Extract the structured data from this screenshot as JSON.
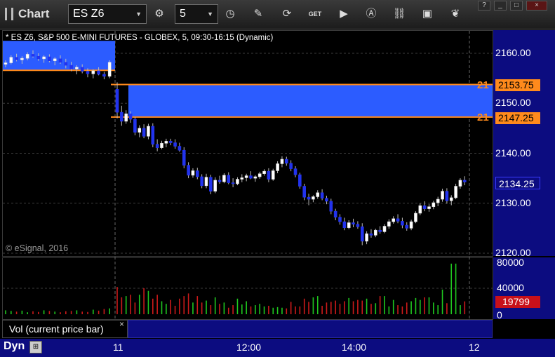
{
  "app": {
    "title": "Chart"
  },
  "toolbar": {
    "symbol": "ES Z6",
    "interval": "5",
    "tools": [
      "clock-icon",
      "pencil-icon",
      "refresh-icon",
      "get-icon",
      "play-icon",
      "alert-icon",
      "link-icon",
      "comment-icon",
      "twitter-icon"
    ],
    "get_label": "GET"
  },
  "window_buttons": {
    "help": "?",
    "minimize": "_",
    "maximize": "□",
    "close": "×"
  },
  "chart_title": "* ES Z6, S&P 500 E-MINI FUTURES - GLOBEX, 5, 09:30-16:15 (Dynamic)",
  "copyright": "© eSignal, 2016",
  "price_axis": {
    "ticks": [
      "2160.00",
      "2150.00",
      "2140.00",
      "2130.00",
      "2120.00"
    ]
  },
  "volume_axis": {
    "ticks": [
      "80000",
      "40000",
      "0"
    ]
  },
  "horizontal_lines": [
    {
      "prefix": "21",
      "label": "2153.75",
      "value": 2153.75
    },
    {
      "prefix": "21",
      "label": "2147.25",
      "value": 2147.25
    }
  ],
  "last_price_label": "2134.25",
  "current_volume_label": "19799",
  "study_label": "Vol (current price bar)",
  "study_close": "×",
  "bottom": {
    "mode": "Dyn",
    "time_ticks": [
      "11",
      "12:00",
      "14:00",
      "12"
    ]
  },
  "colors": {
    "zone": "#2c5cff",
    "zone_line": "#ff8a1c",
    "up_volume": "#1fc81f",
    "down_volume": "#cc1a1a",
    "axis_panel": "#0c0c80"
  },
  "chart_data": {
    "type": "candlestick",
    "ylim": [
      2119,
      2167
    ],
    "volume_ylim": [
      0,
      85000
    ],
    "zones": [
      {
        "from": 2156.6,
        "to": 2162.5,
        "session": "prior"
      },
      {
        "from": 2147.25,
        "to": 2153.75,
        "session": "current"
      }
    ],
    "candles_prior": [
      [
        2157.8,
        2158.6,
        2157.2,
        2158.1
      ],
      [
        2158.1,
        2159.6,
        2157.8,
        2159.2
      ],
      [
        2159.2,
        2159.9,
        2158.4,
        2158.7
      ],
      [
        2158.7,
        2159.4,
        2157.9,
        2159.0
      ],
      [
        2159.0,
        2160.2,
        2158.6,
        2159.8
      ],
      [
        2159.8,
        2160.6,
        2159.1,
        2159.4
      ],
      [
        2159.4,
        2160.0,
        2158.5,
        2158.9
      ],
      [
        2158.9,
        2159.6,
        2158.1,
        2159.3
      ],
      [
        2159.3,
        2159.8,
        2158.2,
        2158.5
      ],
      [
        2158.5,
        2159.2,
        2157.6,
        2158.9
      ],
      [
        2158.9,
        2159.6,
        2157.9,
        2158.2
      ],
      [
        2158.2,
        2158.9,
        2157.0,
        2157.6
      ],
      [
        2157.6,
        2158.3,
        2156.4,
        2156.9
      ],
      [
        2156.9,
        2157.6,
        2155.8,
        2157.2
      ],
      [
        2157.2,
        2157.8,
        2156.0,
        2156.4
      ],
      [
        2156.4,
        2157.0,
        2155.2,
        2155.9
      ],
      [
        2155.9,
        2156.8,
        2155.0,
        2156.5
      ],
      [
        2156.5,
        2157.2,
        2155.6,
        2155.8
      ],
      [
        2155.8,
        2156.3,
        2154.8,
        2155.4
      ],
      [
        2155.4,
        2158.6,
        2155.0,
        2158.2
      ]
    ],
    "candles": [
      [
        2152.8,
        2154.2,
        2147.0,
        2148.2
      ],
      [
        2148.2,
        2149.5,
        2145.5,
        2146.4
      ],
      [
        2146.4,
        2148.6,
        2145.9,
        2147.9
      ],
      [
        2147.9,
        2148.4,
        2146.1,
        2146.8
      ],
      [
        2146.8,
        2147.2,
        2143.6,
        2144.2
      ],
      [
        2144.2,
        2145.6,
        2143.2,
        2145.0
      ],
      [
        2145.0,
        2145.8,
        2143.0,
        2143.4
      ],
      [
        2143.4,
        2145.9,
        2142.8,
        2145.4
      ],
      [
        2145.4,
        2146.0,
        2141.2,
        2141.8
      ],
      [
        2141.8,
        2142.8,
        2140.4,
        2141.1
      ],
      [
        2141.1,
        2142.5,
        2140.8,
        2142.0
      ],
      [
        2142.0,
        2142.9,
        2141.2,
        2142.4
      ],
      [
        2142.4,
        2142.9,
        2141.6,
        2142.1
      ],
      [
        2142.1,
        2142.8,
        2140.9,
        2141.4
      ],
      [
        2141.4,
        2142.1,
        2140.3,
        2140.6
      ],
      [
        2140.6,
        2141.2,
        2137.0,
        2137.6
      ],
      [
        2137.6,
        2138.2,
        2135.0,
        2135.6
      ],
      [
        2135.6,
        2137.0,
        2135.1,
        2136.5
      ],
      [
        2136.5,
        2137.1,
        2134.8,
        2135.3
      ],
      [
        2135.3,
        2135.8,
        2133.0,
        2133.5
      ],
      [
        2133.5,
        2135.9,
        2133.0,
        2135.2
      ],
      [
        2135.2,
        2135.7,
        2131.8,
        2132.4
      ],
      [
        2132.4,
        2135.2,
        2132.0,
        2134.6
      ],
      [
        2134.6,
        2135.5,
        2133.9,
        2134.3
      ],
      [
        2134.3,
        2136.0,
        2134.0,
        2135.6
      ],
      [
        2135.6,
        2136.2,
        2133.8,
        2134.1
      ],
      [
        2134.1,
        2135.0,
        2133.2,
        2133.9
      ],
      [
        2133.9,
        2135.2,
        2133.6,
        2134.8
      ],
      [
        2134.8,
        2135.8,
        2134.2,
        2135.1
      ],
      [
        2135.1,
        2135.9,
        2134.4,
        2135.5
      ],
      [
        2135.5,
        2136.4,
        2134.8,
        2135.0
      ],
      [
        2135.0,
        2135.6,
        2134.3,
        2135.3
      ],
      [
        2135.3,
        2136.3,
        2134.9,
        2135.9
      ],
      [
        2135.9,
        2136.8,
        2135.5,
        2136.4
      ],
      [
        2136.4,
        2137.0,
        2134.2,
        2134.8
      ],
      [
        2134.8,
        2136.9,
        2134.5,
        2136.5
      ],
      [
        2136.5,
        2138.4,
        2136.0,
        2137.9
      ],
      [
        2137.9,
        2139.4,
        2137.2,
        2138.8
      ],
      [
        2138.8,
        2139.3,
        2137.5,
        2138.0
      ],
      [
        2138.0,
        2138.6,
        2136.4,
        2136.9
      ],
      [
        2136.9,
        2137.4,
        2135.2,
        2135.7
      ],
      [
        2135.7,
        2136.1,
        2132.9,
        2133.4
      ],
      [
        2133.4,
        2133.9,
        2130.6,
        2131.2
      ],
      [
        2131.2,
        2131.9,
        2129.6,
        2130.8
      ],
      [
        2130.8,
        2131.6,
        2130.2,
        2131.3
      ],
      [
        2131.3,
        2132.6,
        2130.9,
        2132.1
      ],
      [
        2132.1,
        2132.8,
        2130.6,
        2131.0
      ],
      [
        2131.0,
        2131.5,
        2129.8,
        2130.4
      ],
      [
        2130.4,
        2130.9,
        2127.8,
        2128.4
      ],
      [
        2128.4,
        2128.9,
        2126.6,
        2127.2
      ],
      [
        2127.2,
        2127.8,
        2125.7,
        2126.3
      ],
      [
        2126.3,
        2127.1,
        2124.6,
        2125.1
      ],
      [
        2125.1,
        2126.6,
        2124.8,
        2126.1
      ],
      [
        2126.1,
        2126.9,
        2125.2,
        2125.8
      ],
      [
        2125.8,
        2126.4,
        2124.9,
        2125.3
      ],
      [
        2125.3,
        2126.0,
        2121.6,
        2122.4
      ],
      [
        2122.4,
        2124.4,
        2121.8,
        2123.9
      ],
      [
        2123.9,
        2124.8,
        2123.1,
        2123.6
      ],
      [
        2123.6,
        2124.9,
        2123.2,
        2124.6
      ],
      [
        2124.6,
        2125.4,
        2123.9,
        2124.3
      ],
      [
        2124.3,
        2125.8,
        2124.0,
        2125.4
      ],
      [
        2125.4,
        2126.8,
        2124.9,
        2126.3
      ],
      [
        2126.3,
        2127.4,
        2125.9,
        2126.9
      ],
      [
        2126.9,
        2127.8,
        2126.0,
        2126.4
      ],
      [
        2126.4,
        2127.1,
        2125.0,
        2125.6
      ],
      [
        2125.6,
        2126.2,
        2124.5,
        2125.0
      ],
      [
        2125.0,
        2126.7,
        2124.6,
        2126.3
      ],
      [
        2126.3,
        2128.4,
        2126.0,
        2128.0
      ],
      [
        2128.0,
        2130.0,
        2127.6,
        2129.5
      ],
      [
        2129.5,
        2130.4,
        2128.4,
        2128.9
      ],
      [
        2128.9,
        2129.8,
        2128.3,
        2129.3
      ],
      [
        2129.3,
        2130.5,
        2128.8,
        2130.1
      ],
      [
        2130.1,
        2131.3,
        2129.4,
        2130.8
      ],
      [
        2130.8,
        2132.9,
        2130.3,
        2132.4
      ],
      [
        2132.4,
        2133.0,
        2129.9,
        2130.5
      ],
      [
        2130.5,
        2131.6,
        2129.6,
        2131.1
      ],
      [
        2131.1,
        2133.9,
        2130.8,
        2133.4
      ],
      [
        2133.4,
        2135.0,
        2132.9,
        2134.6
      ],
      [
        2134.6,
        2135.4,
        2133.6,
        2134.25
      ]
    ],
    "volume_prior": [
      6000,
      5000,
      4000,
      5500,
      3000,
      4500,
      3500,
      6000,
      5000,
      4000,
      3000,
      4500,
      5000,
      6000,
      4000,
      3500,
      7000,
      5500,
      8000,
      9000
    ],
    "volume": [
      42000,
      26000,
      28000,
      30000,
      18000,
      30000,
      40000,
      36000,
      24000,
      30000,
      20000,
      16000,
      22000,
      13000,
      24000,
      28000,
      32000,
      18000,
      28000,
      18000,
      21000,
      14000,
      26000,
      16000,
      18000,
      10000,
      14000,
      24000,
      15000,
      20000,
      12000,
      14000,
      16000,
      12000,
      13000,
      10000,
      11000,
      10000,
      9000,
      19000,
      12000,
      12000,
      24000,
      19000,
      26000,
      28000,
      13000,
      18000,
      19000,
      21000,
      16000,
      20000,
      25000,
      20000,
      22000,
      21000,
      24000,
      16000,
      17000,
      28000,
      28000,
      12000,
      22000,
      14000,
      12000,
      18000,
      20000,
      25000,
      22000,
      26000,
      26000,
      18000,
      14000,
      38000,
      17000,
      78000,
      78000,
      14000,
      19799
    ]
  }
}
